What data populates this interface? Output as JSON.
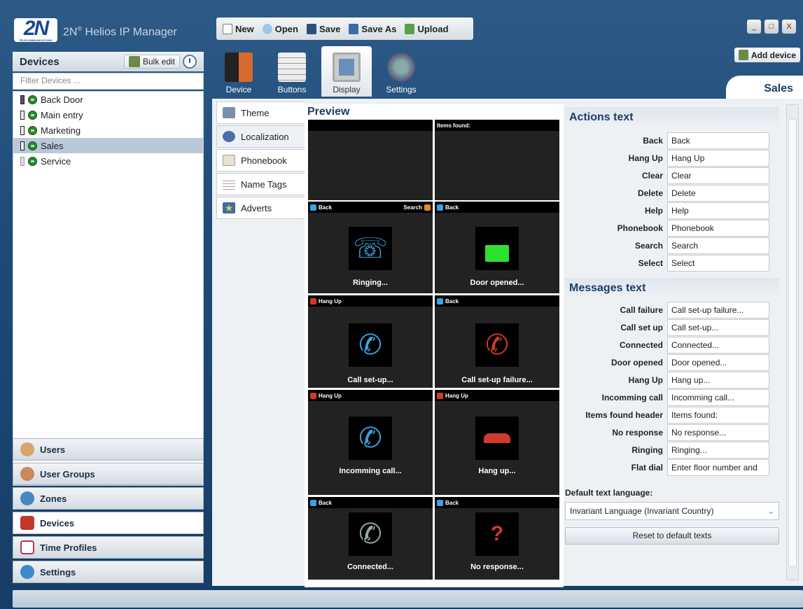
{
  "app": {
    "logo_text": "2N",
    "logo_sub": "TELECOMMUNICATIONS",
    "brand": "2N",
    "reg": "®",
    "title": " Helios IP Manager"
  },
  "toolbar": {
    "new": "New",
    "open": "Open",
    "save": "Save",
    "save_as": "Save As",
    "upload": "Upload"
  },
  "window": {
    "minimize": "_",
    "maximize": "□",
    "close": "X"
  },
  "devices_panel": {
    "title": "Devices",
    "bulk_edit": "Bulk edit",
    "filter_placeholder": "Filter Devices ..."
  },
  "devices": [
    {
      "name": "Back Door",
      "selected": false
    },
    {
      "name": "Main entry",
      "selected": false
    },
    {
      "name": "Marketing",
      "selected": false
    },
    {
      "name": "Sales",
      "selected": true
    },
    {
      "name": "Service",
      "selected": false
    }
  ],
  "nav": {
    "users": "Users",
    "user_groups": "User Groups",
    "zones": "Zones",
    "devices": "Devices",
    "time_profiles": "Time Profiles",
    "settings": "Settings"
  },
  "ribbon": {
    "device": "Device",
    "buttons": "Buttons",
    "display": "Display",
    "settings": "Settings",
    "add_device": "Add device",
    "current_device": "Sales"
  },
  "side_tabs": {
    "theme": "Theme",
    "localization": "Localization",
    "phonebook": "Phonebook",
    "name_tags": "Name Tags",
    "adverts": "Adverts"
  },
  "preview": {
    "title": "Preview",
    "items_found": "Items found:",
    "bars": {
      "back": "Back",
      "search": "Search",
      "hang_up": "Hang Up"
    },
    "screens": {
      "ringing": "Ringing...",
      "door_opened": "Door opened...",
      "call_setup": "Call set-up...",
      "call_failure": "Call set-up failure...",
      "incoming": "Incomming call...",
      "hang_up": "Hang up...",
      "connected": "Connected...",
      "no_response": "No response..."
    }
  },
  "actions_text": {
    "title": "Actions text",
    "labels": {
      "back": "Back",
      "hang_up": "Hang Up",
      "clear": "Clear",
      "delete": "Delete",
      "help": "Help",
      "phonebook": "Phonebook",
      "search": "Search",
      "select": "Select"
    },
    "values": {
      "back": "Back",
      "hang_up": "Hang Up",
      "clear": "Clear",
      "delete": "Delete",
      "help": "Help",
      "phonebook": "Phonebook",
      "search": "Search",
      "select": "Select"
    }
  },
  "messages_text": {
    "title": "Messages text",
    "labels": {
      "call_failure": "Call failure",
      "call_set_up": "Call set up",
      "connected": "Connected",
      "door_opened": "Door opened",
      "hang_up": "Hang Up",
      "incomming_call": "Incomming call",
      "items_found_header": "Items found header",
      "no_response": "No response",
      "ringing": "Ringing",
      "flat_dial": "Flat dial"
    },
    "values": {
      "call_failure": "Call set-up failure...",
      "call_set_up": "Call set-up...",
      "connected": "Connected...",
      "door_opened": "Door opened...",
      "hang_up": "Hang up...",
      "incomming_call": "Incomming call...",
      "items_found_header": "Items found:",
      "no_response": "No response...",
      "ringing": "Ringing...",
      "flat_dial": "Enter floor number and"
    }
  },
  "language": {
    "label": "Default text language:",
    "value": "Invariant Language (Invariant Country)",
    "reset": "Reset to default texts"
  },
  "colors": {
    "accent": "#1b3f66",
    "selection": "#b9c9da",
    "status_green": "#2a8a2a"
  }
}
